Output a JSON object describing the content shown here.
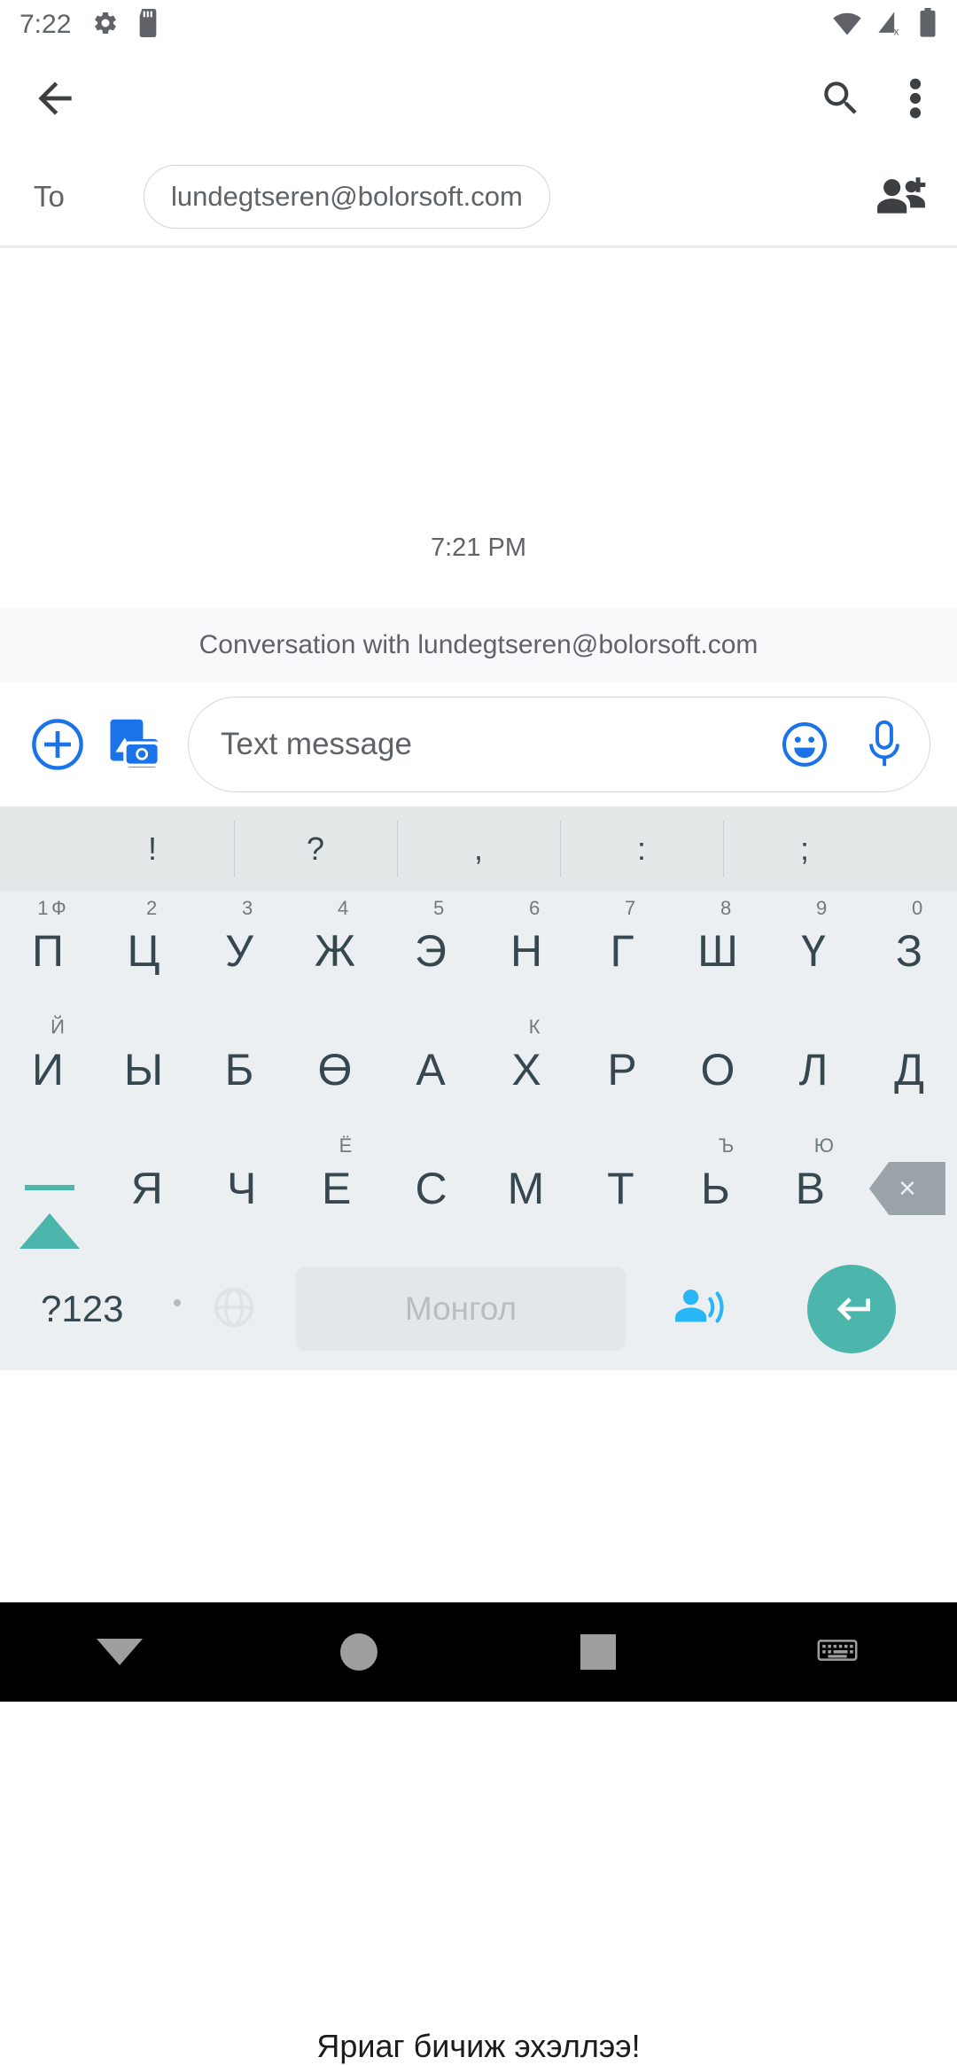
{
  "status_bar": {
    "clock": "7:22",
    "icons": {
      "settings": "gear-icon",
      "sdcard": "sdcard-icon",
      "wifi": "wifi-icon",
      "cellular": "cellular-off-icon",
      "battery": "battery-icon"
    }
  },
  "app_bar": {
    "back": "back-arrow-icon",
    "search": "search-icon",
    "overflow": "more-vertical-icon"
  },
  "recipient": {
    "to_label": "To",
    "chip_value": "lundegtseren@bolorsoft.com",
    "add_contact": "add-person-icon"
  },
  "conversation": {
    "timestamp": "7:21 PM",
    "banner": "Conversation with lundegtseren@bolorsoft.com"
  },
  "compose": {
    "add_label": "plus-circle-icon",
    "media_label": "image-camera-icon",
    "placeholder": "Text message",
    "value": "",
    "emoji_label": "emoji-icon",
    "mic_label": "microphone-icon"
  },
  "keyboard": {
    "punctuation": [
      "!",
      "?",
      ",",
      ":",
      ";"
    ],
    "row1": [
      {
        "key": "П",
        "hint": "1",
        "alt": "Ф"
      },
      {
        "key": "Ц",
        "hint": "2",
        "alt": ""
      },
      {
        "key": "У",
        "hint": "3",
        "alt": ""
      },
      {
        "key": "Ж",
        "hint": "4",
        "alt": ""
      },
      {
        "key": "Э",
        "hint": "5",
        "alt": ""
      },
      {
        "key": "Н",
        "hint": "6",
        "alt": ""
      },
      {
        "key": "Г",
        "hint": "7",
        "alt": ""
      },
      {
        "key": "Ш",
        "hint": "8",
        "alt": ""
      },
      {
        "key": "Ү",
        "hint": "9",
        "alt": ""
      },
      {
        "key": "З",
        "hint": "0",
        "alt": ""
      }
    ],
    "row2": [
      {
        "key": "И",
        "alt": "Й"
      },
      {
        "key": "Ы",
        "alt": ""
      },
      {
        "key": "Б",
        "alt": ""
      },
      {
        "key": "Ө",
        "alt": ""
      },
      {
        "key": "А",
        "alt": ""
      },
      {
        "key": "Х",
        "alt": "К"
      },
      {
        "key": "Р",
        "alt": ""
      },
      {
        "key": "О",
        "alt": ""
      },
      {
        "key": "Л",
        "alt": ""
      },
      {
        "key": "Д",
        "alt": ""
      }
    ],
    "row3": [
      {
        "key": "Я",
        "alt": ""
      },
      {
        "key": "Ч",
        "alt": ""
      },
      {
        "key": "Е",
        "alt": "Ё"
      },
      {
        "key": "С",
        "alt": ""
      },
      {
        "key": "М",
        "alt": ""
      },
      {
        "key": "Т",
        "alt": ""
      },
      {
        "key": "Ь",
        "alt": "Ъ"
      },
      {
        "key": "В",
        "alt": "Ю"
      }
    ],
    "shift_label": "shift-icon",
    "backspace_label": "×",
    "bottom": {
      "symbols": "?123",
      "globe": "globe-icon",
      "space_label": "Монгол",
      "voice": "voice-input-icon",
      "enter": "enter-icon"
    },
    "toast": "Яриаг бичиж эхэллээ!"
  },
  "nav_bar": {
    "back": "nav-back-icon",
    "home": "nav-home-icon",
    "recents": "nav-recents-icon",
    "keyboard": "nav-keyboard-icon"
  },
  "colors": {
    "accent_blue": "#1a73e8",
    "accent_teal": "#4db6ac",
    "key_text": "#36474f",
    "keyboard_bg": "#eceff1"
  }
}
